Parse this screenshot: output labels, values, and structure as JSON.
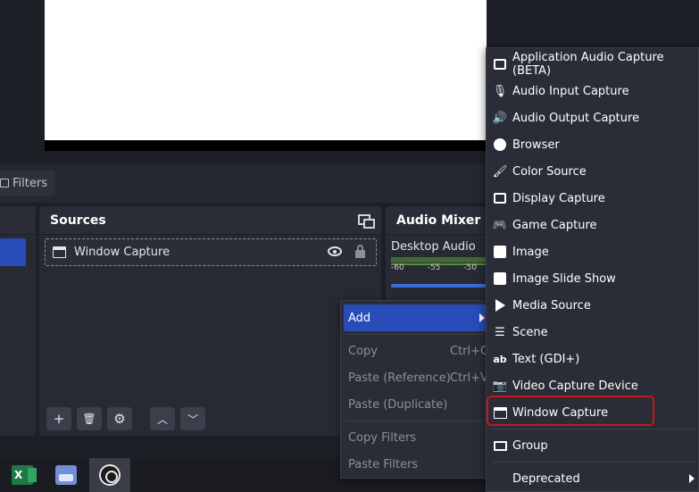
{
  "filters_button": {
    "label": "Filters"
  },
  "sources": {
    "title": "Sources",
    "items": [
      {
        "label": "Window Capture"
      }
    ],
    "toolbar": {
      "add": "+",
      "remove": "🗑",
      "settings": "⚙",
      "up": "︿",
      "down": "﹀"
    }
  },
  "mixer": {
    "title": "Audio Mixer",
    "channel": "Desktop Audio",
    "ticks": [
      "-60",
      "-55",
      "-50"
    ]
  },
  "context_menu": {
    "add": "Add",
    "copy": "Copy",
    "copy_shortcut": "Ctrl+C",
    "paste_reference": "Paste (Reference)",
    "paste_reference_shortcut": "Ctrl+V",
    "paste_duplicate": "Paste (Duplicate)",
    "copy_filters": "Copy Filters",
    "paste_filters": "Paste Filters"
  },
  "add_submenu": {
    "items": [
      {
        "label": "Application Audio Capture (BETA)",
        "icon": "app-audio-icon"
      },
      {
        "label": "Audio Input Capture",
        "icon": "microphone-icon"
      },
      {
        "label": "Audio Output Capture",
        "icon": "speaker-icon"
      },
      {
        "label": "Browser",
        "icon": "globe-icon"
      },
      {
        "label": "Color Source",
        "icon": "brush-icon"
      },
      {
        "label": "Display Capture",
        "icon": "monitor-icon"
      },
      {
        "label": "Game Capture",
        "icon": "gamepad-icon"
      },
      {
        "label": "Image",
        "icon": "image-icon"
      },
      {
        "label": "Image Slide Show",
        "icon": "slideshow-icon"
      },
      {
        "label": "Media Source",
        "icon": "play-icon"
      },
      {
        "label": "Scene",
        "icon": "list-icon"
      },
      {
        "label": "Text (GDI+)",
        "icon": "text-icon"
      },
      {
        "label": "Video Capture Device",
        "icon": "camera-icon"
      },
      {
        "label": "Window Capture",
        "icon": "window-icon"
      },
      {
        "label": "Group",
        "icon": "folder-icon"
      },
      {
        "label": "Deprecated",
        "icon": ""
      }
    ]
  },
  "taskbar": {
    "excel_letter": "X"
  },
  "colors": {
    "accent": "#284cb8",
    "highlight_box": "#c8161d",
    "menu_bg": "#2a2d37"
  }
}
